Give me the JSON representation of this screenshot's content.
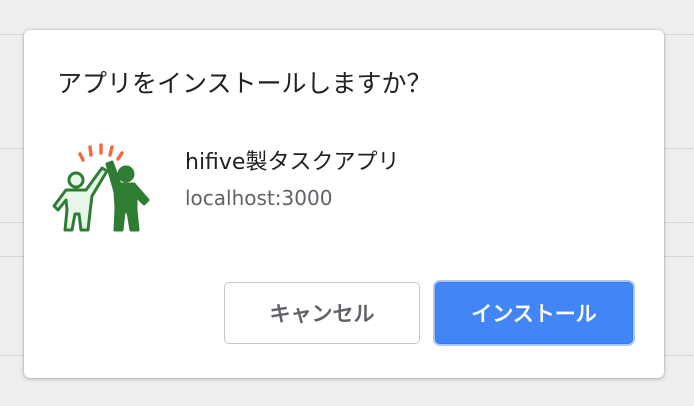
{
  "dialog": {
    "title": "アプリをインストールしますか？",
    "app_name": "hifive製タスクアプリ",
    "app_origin": "localhost:3000",
    "app_icon": "high-five-people-icon"
  },
  "buttons": {
    "cancel_label": "キャンセル",
    "install_label": "インストール"
  },
  "colors": {
    "primary": "#4285f4",
    "icon_green": "#2e7d32",
    "icon_orange": "#f26b3a"
  }
}
